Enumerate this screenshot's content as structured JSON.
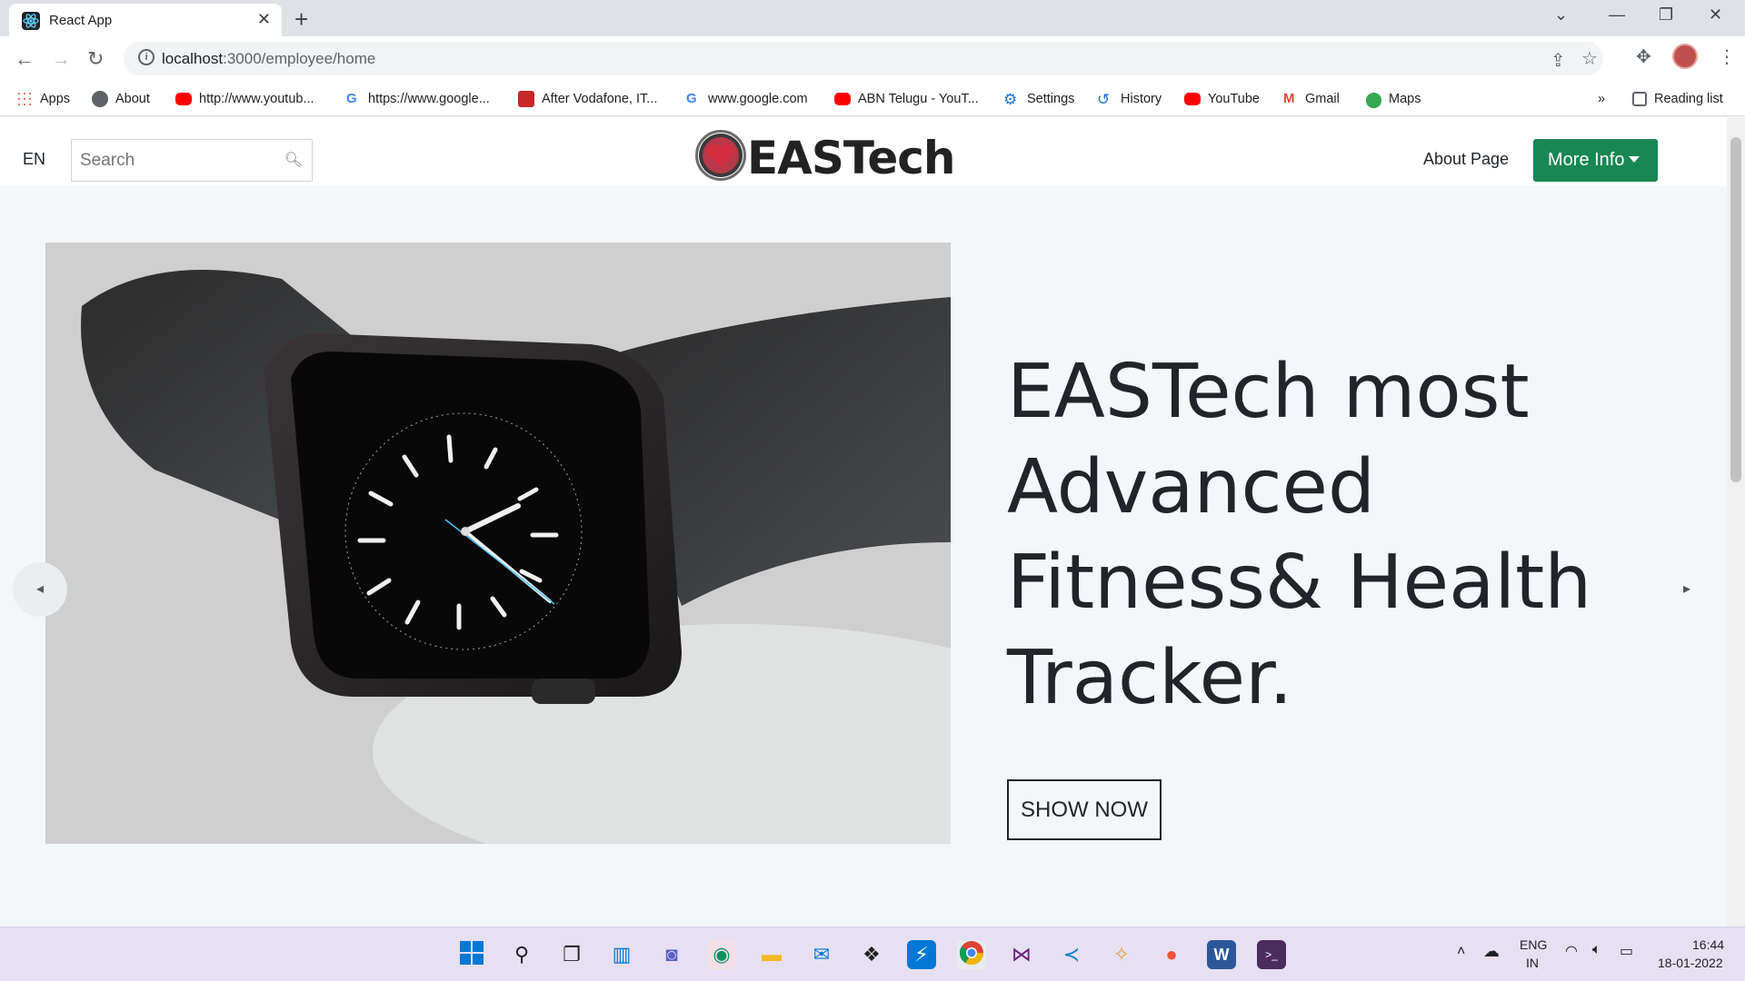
{
  "browser": {
    "tab_title": "React App",
    "url_host": "localhost",
    "url_path": ":3000/employee/home",
    "bookmarks": [
      {
        "label": "Apps"
      },
      {
        "label": "About"
      },
      {
        "label": "http://www.youtub..."
      },
      {
        "label": "https://www.google..."
      },
      {
        "label": "After Vodafone, IT..."
      },
      {
        "label": "www.google.com"
      },
      {
        "label": "ABN Telugu - YouT..."
      },
      {
        "label": "Settings"
      },
      {
        "label": "History"
      },
      {
        "label": "YouTube"
      },
      {
        "label": "Gmail"
      },
      {
        "label": "Maps"
      }
    ],
    "reading_list": "Reading list",
    "overflow": "»"
  },
  "navbar": {
    "lang": "EN",
    "search_placeholder": "Search",
    "brand": "EASTech",
    "about_link": "About Page",
    "more_info": "More Info"
  },
  "hero": {
    "headline": "EASTech most Advanced Fitness& Health Tracker.",
    "cta": "SHOW NOW"
  },
  "taskbar": {
    "lang_top": "ENG",
    "lang_bottom": "IN",
    "time": "16:44",
    "date": "18-01-2022"
  },
  "colors": {
    "accent_green": "#198754",
    "text_dark": "#212529",
    "page_bg": "#f3f7f9"
  }
}
